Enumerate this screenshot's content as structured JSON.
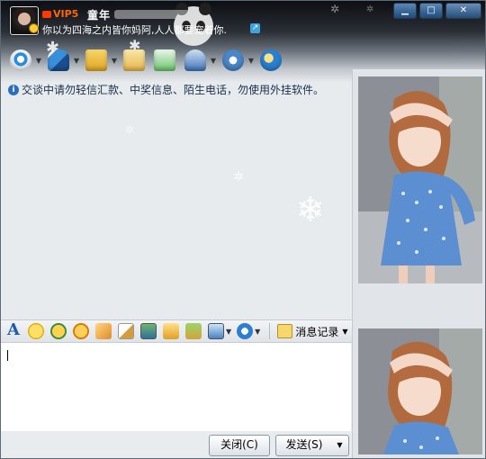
{
  "window": {
    "vip_label": "VIP5",
    "nickname": "童年",
    "signature": "你以为四海之内皆你妈阿,人人都要宠着你.",
    "buttons": [
      "▁",
      "□",
      "✕"
    ]
  },
  "toolbar_icons": [
    "video-call-icon",
    "voice-call-icon",
    "file-transfer-icon",
    "sms-icon",
    "add-app-icon",
    "remote-assist-icon",
    "settings-icon",
    "share-icon"
  ],
  "chat": {
    "notice": "交谈中请勿轻信汇款、中奖信息、陌生电话，勿使用外挂软件。"
  },
  "format_toolbar": {
    "message_record_label": "消息记录"
  },
  "actions": {
    "close_label": "关闭(C)",
    "send_label": "发送(S)"
  },
  "colors": {
    "header_dark": "#0c0e12",
    "accent_blue": "#1f5bb0",
    "vip_orange": "#ff6600"
  }
}
